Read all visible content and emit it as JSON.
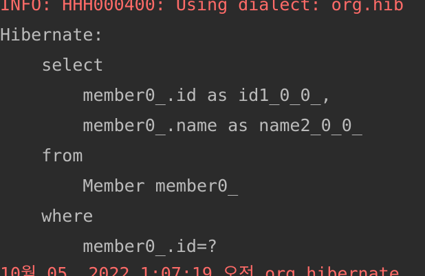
{
  "console": {
    "lines": [
      {
        "text": "INFO: HHH000400: Using dialect: org.hib",
        "kind": "stderr"
      },
      {
        "text": "Hibernate:",
        "kind": "stdout"
      },
      {
        "text": "    select",
        "kind": "stdout"
      },
      {
        "text": "        member0_.id as id1_0_0_,",
        "kind": "stdout"
      },
      {
        "text": "        member0_.name as name2_0_0_",
        "kind": "stdout"
      },
      {
        "text": "    from",
        "kind": "stdout"
      },
      {
        "text": "        Member member0_",
        "kind": "stdout"
      },
      {
        "text": "    where",
        "kind": "stdout"
      },
      {
        "text": "        member0_.id=?",
        "kind": "stdout"
      },
      {
        "text": "10월 05, 2022 1:07:19 오전 org.hibernate",
        "kind": "stderr"
      }
    ]
  },
  "colors": {
    "background": "#2b2b2b",
    "stdout": "#bbbbbb",
    "stderr": "#ff6b68"
  }
}
